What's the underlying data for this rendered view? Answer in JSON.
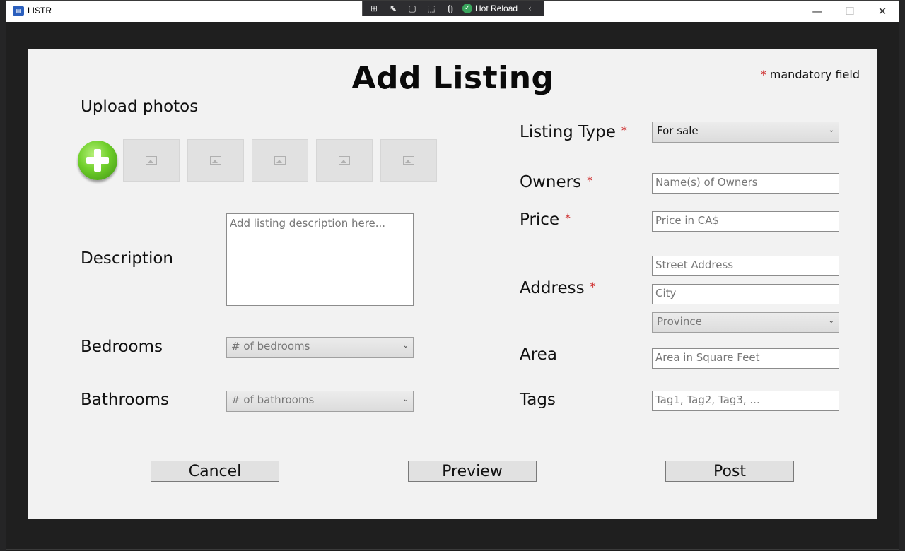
{
  "window": {
    "title": "LISTR",
    "minimize_glyph": "—",
    "maximize_glyph": "☐",
    "close_glyph": "✕"
  },
  "debug_toolbar": {
    "hot_reload_label": "Hot Reload",
    "icons": [
      "select-element-icon",
      "select-pointer-icon",
      "display-layout-icon",
      "track-focus-icon",
      "binding-failures-icon"
    ]
  },
  "form": {
    "heading": "Add Listing",
    "mandatory_note": "mandatory field",
    "required_marker": "*",
    "upload": {
      "label": "Upload photos",
      "slot_count": 5
    },
    "description": {
      "label": "Description",
      "placeholder": "Add listing description here..."
    },
    "bedrooms": {
      "label": "Bedrooms",
      "placeholder": "# of bedrooms"
    },
    "bathrooms": {
      "label": "Bathrooms",
      "placeholder": "# of bathrooms"
    },
    "listing_type": {
      "label": "Listing Type",
      "value": "For sale"
    },
    "owners": {
      "label": "Owners",
      "placeholder": "Name(s) of Owners"
    },
    "price": {
      "label": "Price",
      "placeholder": "Price in CA$"
    },
    "address": {
      "label": "Address",
      "street_placeholder": "Street Address",
      "city_placeholder": "City",
      "province_placeholder": "Province"
    },
    "area": {
      "label": "Area",
      "placeholder": "Area in Square Feet"
    },
    "tags": {
      "label": "Tags",
      "placeholder": "Tag1, Tag2, Tag3, ..."
    },
    "buttons": {
      "cancel": "Cancel",
      "preview": "Preview",
      "post": "Post"
    }
  },
  "colors": {
    "required_star": "#cc2222",
    "panel_bg": "#f2f2f2",
    "add_photo_green": "#6fcf2a"
  }
}
